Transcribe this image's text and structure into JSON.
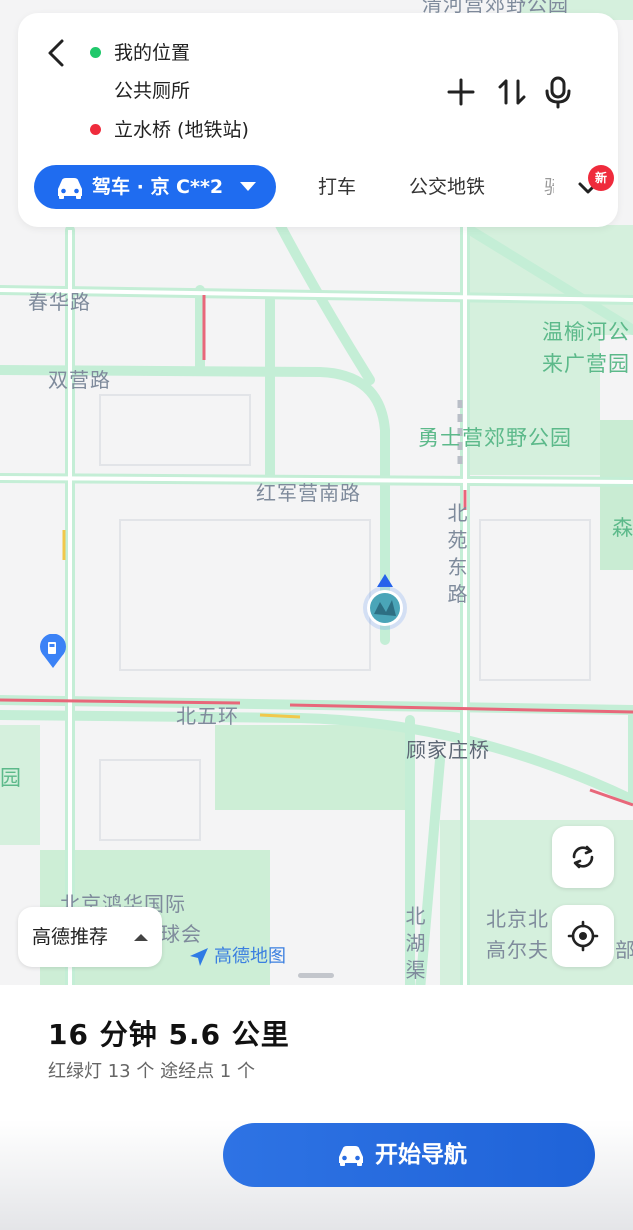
{
  "route": {
    "origin": "我的位置",
    "waypoint": "公共厕所",
    "destination": "立水桥 (地铁站)",
    "origin_color": "#20c86b",
    "destination_color": "#ef2b3c"
  },
  "modes": {
    "active": "驾车 · 京 C**2",
    "tabs": [
      "打车",
      "公交地铁",
      "骑"
    ],
    "new_badge": "新"
  },
  "map": {
    "labels": {
      "top_partial": "清河营郊野公园",
      "chunhua": "春华路",
      "shuangying": "双营路",
      "wenyu": "温榆河公",
      "laiguang": "来广营园",
      "yongshi": "勇士营郊野公园",
      "hongjun": "红军营南路",
      "beiyuan_east": "北苑东路",
      "beiwuhuan": "北五环",
      "gujiazhuang": "顾家庄桥",
      "yuan_left": "园",
      "beijing_honghua": "北京鸿华国际",
      "qiuhui": "球会",
      "beijing_bei": "北京北",
      "gaoerfu": "高尔夫",
      "beihuqu": "北湖渠",
      "sen": "森",
      "bu": "部"
    },
    "recommend_label": "高德推荐",
    "logo_text": "高德地图"
  },
  "summary": {
    "eta": "16 分钟   5.6 公里",
    "meta": "红绿灯 13 个   途经点 1 个",
    "start_label": "开始导航"
  },
  "colors": {
    "accent": "#1f6cf0",
    "park_green": "#c9ecd3",
    "road_stroke": "#bfe8cf"
  }
}
